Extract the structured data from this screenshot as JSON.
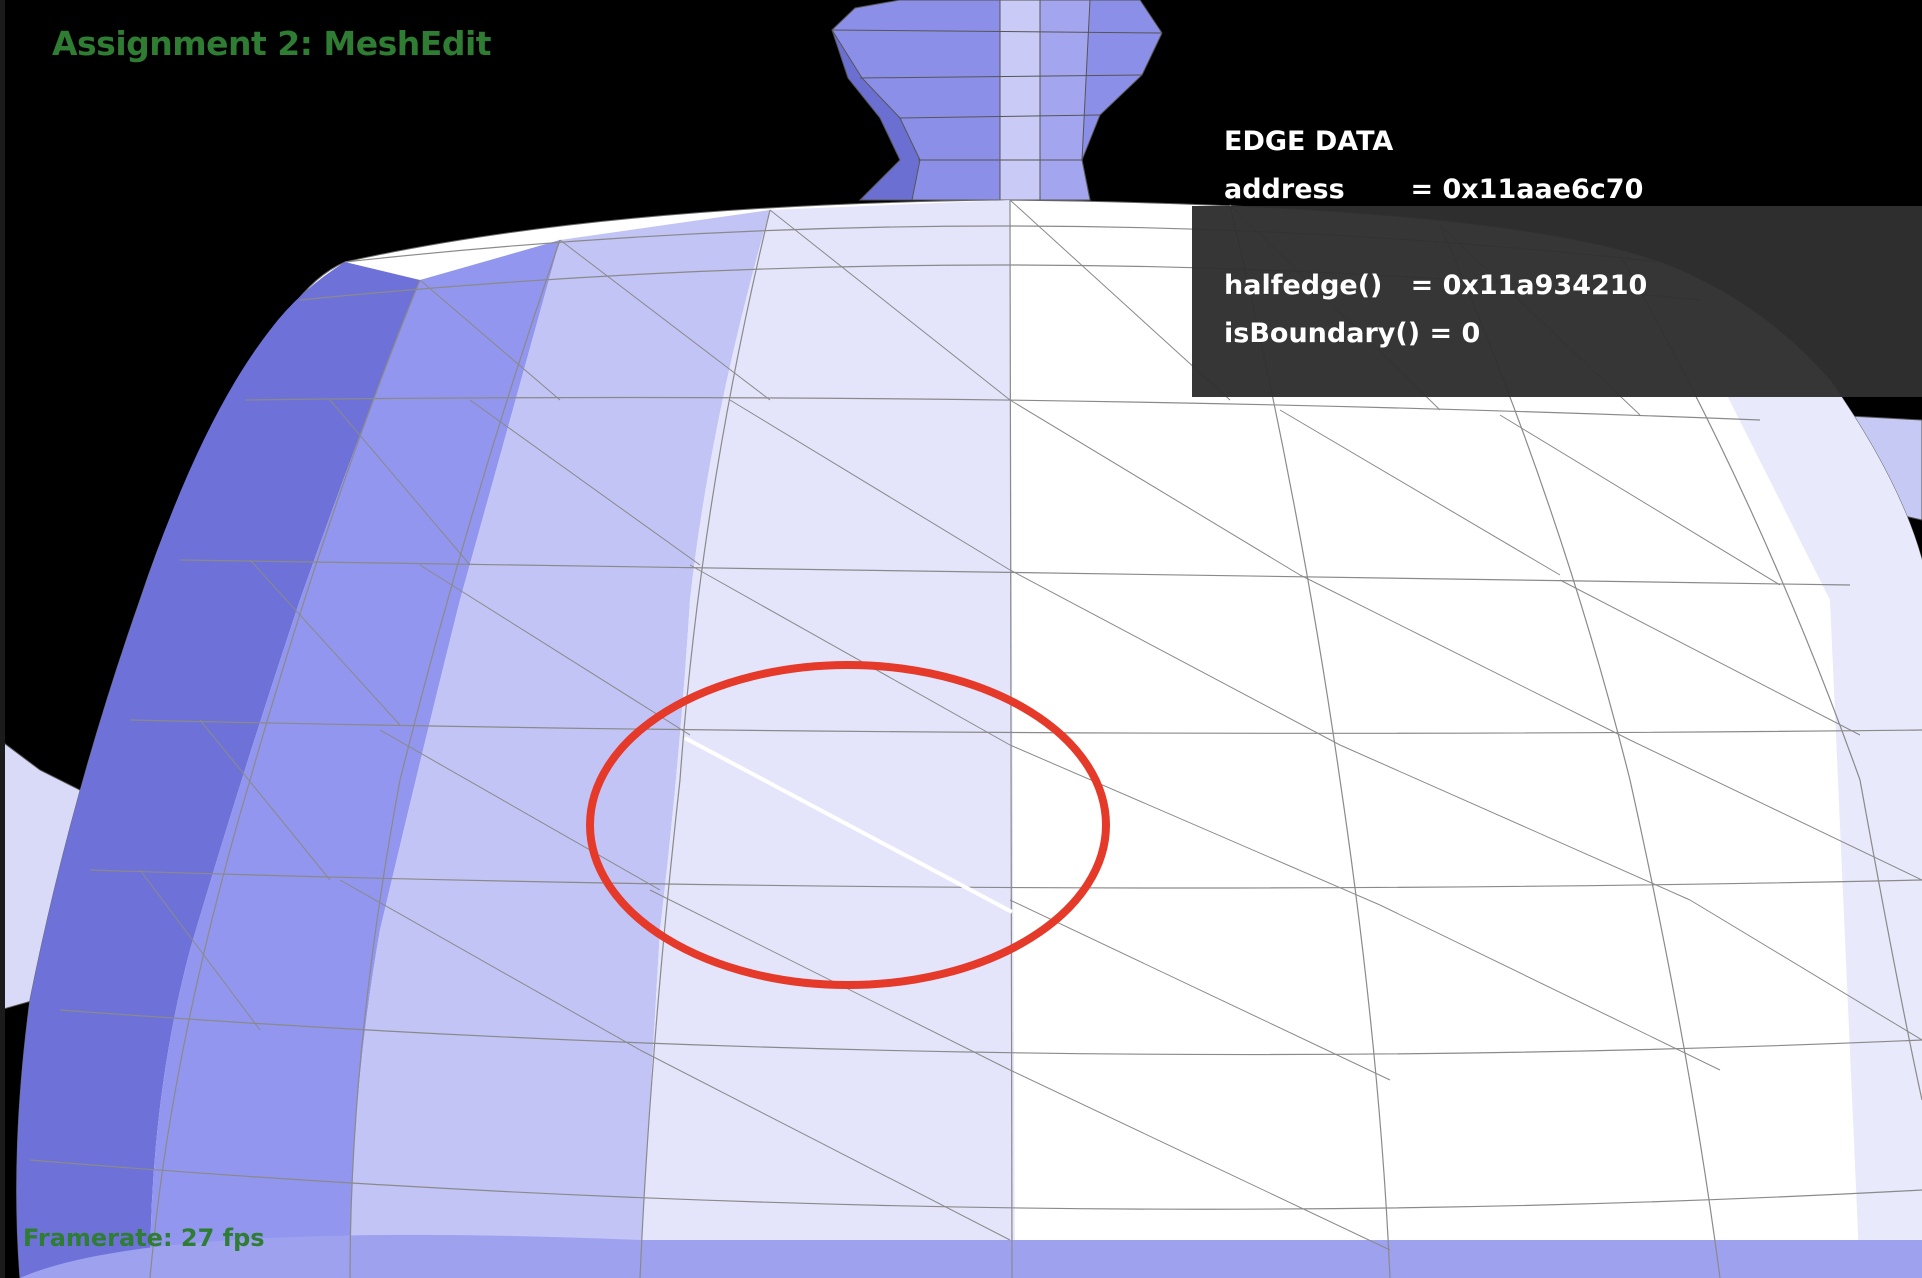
{
  "app": {
    "title": "Assignment 2: MeshEdit",
    "framerate": "Framerate: 27 fps",
    "accent_color": "#2e7d32"
  },
  "edge_panel": {
    "heading": "EDGE DATA",
    "address_line": "address       = 0x11aae6c70",
    "halfedge_line": "halfedge()   = 0x11a934210",
    "isboundary_line": "isBoundary() = 0",
    "background_color": "#303030"
  },
  "viewport": {
    "mesh_name": "teapot",
    "render_mode": "flat shaded wireframe",
    "selected_element": "edge",
    "selection_highlight_color": "#ffffff",
    "annotation_color": "#e53a2a"
  }
}
